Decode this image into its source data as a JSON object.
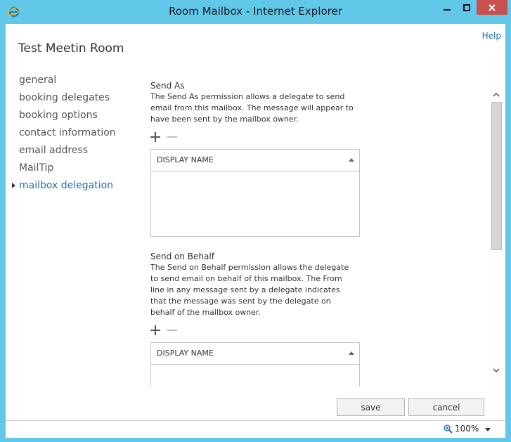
{
  "window": {
    "title": "Room Mailbox - Internet Explorer",
    "titlebar_color": "#62c8ea",
    "close_color": "#c75050"
  },
  "header": {
    "help": "Help",
    "page_title": "Test Meetin Room"
  },
  "sidebar": {
    "items": [
      {
        "label": "general",
        "active": false
      },
      {
        "label": "booking delegates",
        "active": false
      },
      {
        "label": "booking options",
        "active": false
      },
      {
        "label": "contact information",
        "active": false
      },
      {
        "label": "email address",
        "active": false
      },
      {
        "label": "MailTip",
        "active": false
      },
      {
        "label": "mailbox delegation",
        "active": true
      }
    ],
    "active_color": "#1e6fbd"
  },
  "send_as": {
    "heading": "Send As",
    "description": "The Send As permission allows a delegate to send email from this mailbox. The message will appear to have been sent by the mailbox owner.",
    "column_header": "DISPLAY NAME"
  },
  "send_on_behalf": {
    "heading": "Send on Behalf",
    "description": "The Send on Behalf permission allows the delegate to send email on behalf of this mailbox. The From line in any message sent by a delegate indicates that the message was sent by the delegate on behalf of the mailbox owner.",
    "column_header": "DISPLAY NAME"
  },
  "footer": {
    "save": "save",
    "cancel": "cancel"
  },
  "statusbar": {
    "zoom": "100%"
  }
}
